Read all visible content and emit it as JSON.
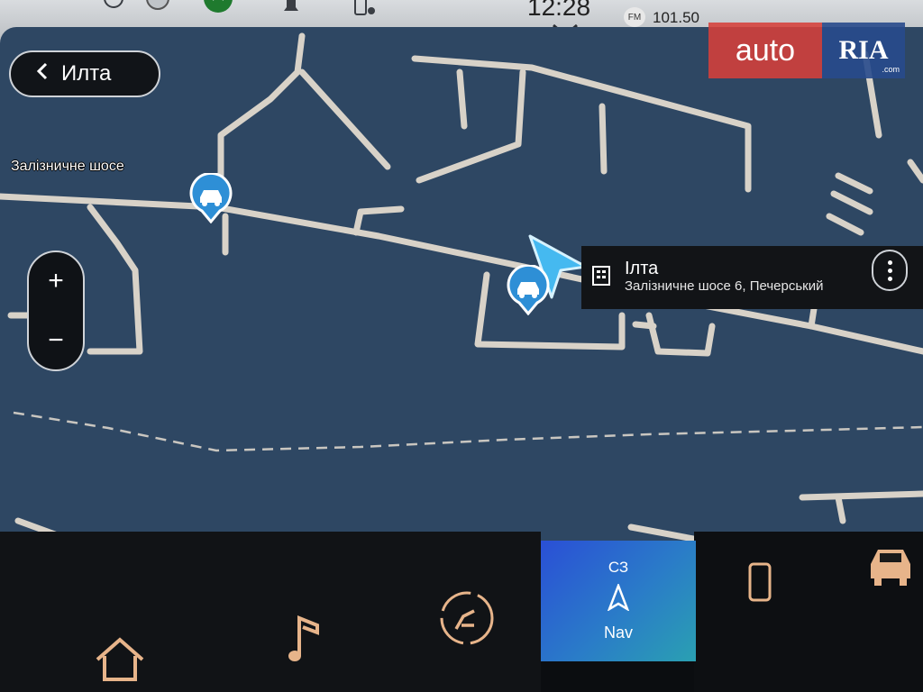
{
  "status_bar": {
    "time": "12:28",
    "radio_band": "FM",
    "radio_frequency": "101.50"
  },
  "watermark": {
    "left_text": "auto",
    "right_text": "RIA",
    "right_small": ".com"
  },
  "navigation": {
    "back_label": "Илта",
    "street_label": "Залізничне шосе",
    "zoom_in": "+",
    "zoom_out": "−",
    "destination": {
      "title": "Ілта",
      "address": "Залізничне шосе 6, Печерський"
    }
  },
  "dock": {
    "nav_direction": "СЗ",
    "nav_label": "Nav",
    "items": [
      "home-icon",
      "music-icon",
      "seat-climate-icon",
      "nav-tile",
      "phone-icon",
      "car-icon"
    ]
  },
  "colors": {
    "map_background": "#2e4763",
    "road": "#d8d2c8",
    "poi_blue": "#2e8fd6",
    "nav_tile_start": "#2a4fd6",
    "nav_tile_end": "#2aa0b2",
    "dock_icon": "#e7b48a"
  }
}
